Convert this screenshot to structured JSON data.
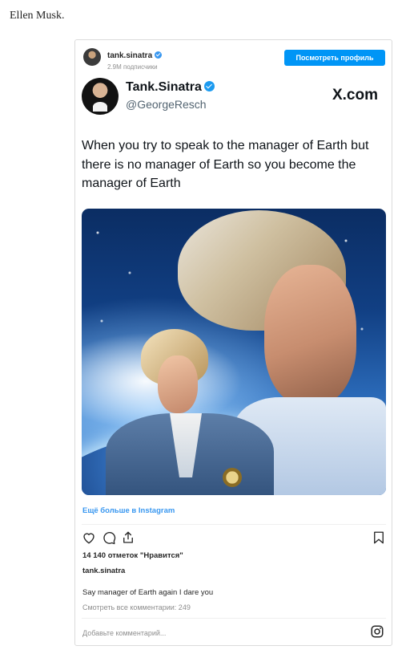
{
  "page": {
    "heading": "Ellen Musk."
  },
  "embed_header": {
    "username": "tank.sinatra",
    "followers": "2.9M подписчики",
    "view_profile_label": "Посмотреть профиль"
  },
  "tweet": {
    "display_name": "Tank.Sinatra",
    "handle": "@GeorgeResch",
    "site": "X.com",
    "text": "When you try to speak to the manager of Earth but there is no manager of Earth so you become the manager of Earth"
  },
  "embed_footer": {
    "more_link": "Ещё больше в Instagram",
    "likes": "14 140 отметок \"Нравится\"",
    "owner": "tank.sinatra",
    "caption": "Say manager of Earth again I dare you",
    "view_all_comments": "Смотреть все комментарии: 249",
    "add_comment_placeholder": "Добавьте комментарий..."
  },
  "icons": {
    "like": "heart-icon",
    "comment": "comment-icon",
    "share": "share-icon",
    "save": "bookmark-icon",
    "instagram": "instagram-icon"
  },
  "colors": {
    "accent": "#0095f6",
    "link": "#3897f0",
    "muted": "#8e8e8e",
    "verified": "#1d9bf0"
  }
}
